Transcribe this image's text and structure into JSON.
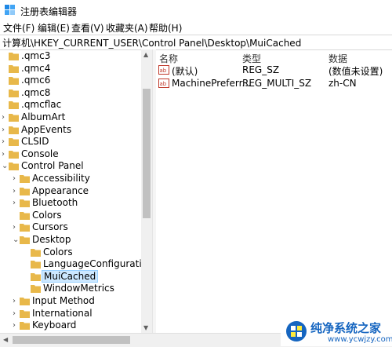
{
  "window": {
    "title": "注册表编辑器"
  },
  "menu": [
    "文件(F)",
    "编辑(E)",
    "查看(V)",
    "收藏夹(A)",
    "帮助(H)"
  ],
  "address": "计算机\\HKEY_CURRENT_USER\\Control Panel\\Desktop\\MuiCached",
  "tree": [
    {
      "label": ".qmc3",
      "indent": 0,
      "expander": "none"
    },
    {
      "label": ".qmc4",
      "indent": 0,
      "expander": "none"
    },
    {
      "label": ".qmc6",
      "indent": 0,
      "expander": "none"
    },
    {
      "label": ".qmc8",
      "indent": 0,
      "expander": "none"
    },
    {
      "label": ".qmcflac",
      "indent": 0,
      "expander": "none"
    },
    {
      "label": "AlbumArt",
      "indent": 0,
      "expander": "collapsed"
    },
    {
      "label": "AppEvents",
      "indent": 0,
      "expander": "collapsed"
    },
    {
      "label": "CLSID",
      "indent": 0,
      "expander": "collapsed"
    },
    {
      "label": "Console",
      "indent": 0,
      "expander": "collapsed"
    },
    {
      "label": "Control Panel",
      "indent": 0,
      "expander": "expanded"
    },
    {
      "label": "Accessibility",
      "indent": 1,
      "expander": "collapsed"
    },
    {
      "label": "Appearance",
      "indent": 1,
      "expander": "collapsed"
    },
    {
      "label": "Bluetooth",
      "indent": 1,
      "expander": "collapsed"
    },
    {
      "label": "Colors",
      "indent": 1,
      "expander": "none"
    },
    {
      "label": "Cursors",
      "indent": 1,
      "expander": "collapsed"
    },
    {
      "label": "Desktop",
      "indent": 1,
      "expander": "expanded"
    },
    {
      "label": "Colors",
      "indent": 2,
      "expander": "none"
    },
    {
      "label": "LanguageConfiguration",
      "indent": 2,
      "expander": "none"
    },
    {
      "label": "MuiCached",
      "indent": 2,
      "expander": "none",
      "selected": true
    },
    {
      "label": "WindowMetrics",
      "indent": 2,
      "expander": "none"
    },
    {
      "label": "Input Method",
      "indent": 1,
      "expander": "collapsed"
    },
    {
      "label": "International",
      "indent": 1,
      "expander": "collapsed"
    },
    {
      "label": "Keyboard",
      "indent": 1,
      "expander": "collapsed"
    }
  ],
  "list": {
    "columns": [
      "名称",
      "类型",
      "数据"
    ],
    "rows": [
      {
        "name": "(默认)",
        "type": "REG_SZ",
        "data": "(数值未设置)",
        "icon": "string-value-icon"
      },
      {
        "name": "MachinePreferr...",
        "type": "REG_MULTI_SZ",
        "data": "zh-CN",
        "icon": "string-value-icon"
      }
    ]
  },
  "watermark": {
    "text": "纯净系统之家",
    "url": "www.ycwjzy.com"
  },
  "colors": {
    "selection": "#cce8ff",
    "folder": "#e8b84a",
    "brand": "#1565c0"
  }
}
